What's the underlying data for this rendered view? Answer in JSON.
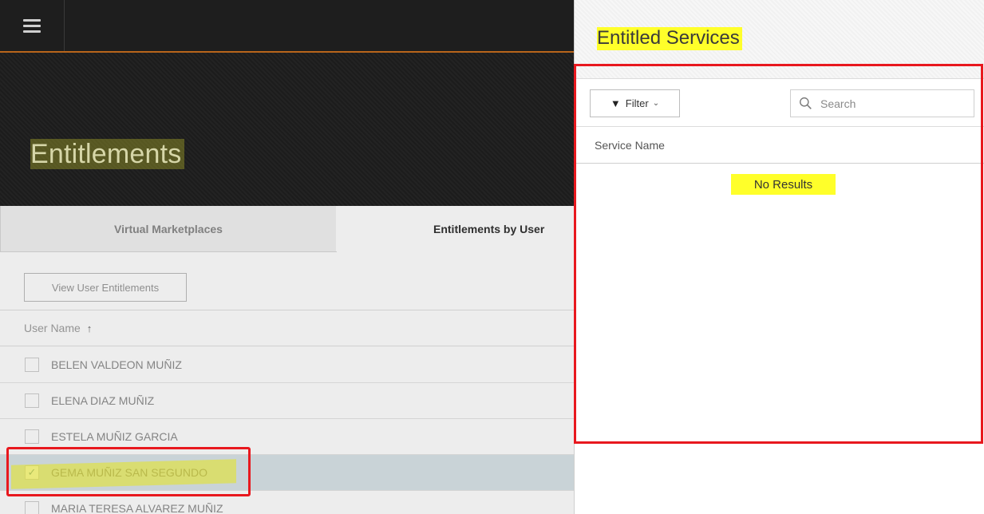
{
  "page": {
    "title": "Entitlements"
  },
  "tabs": [
    {
      "label": "Virtual Marketplaces"
    },
    {
      "label": "Entitlements by User"
    }
  ],
  "toolbar": {
    "view_button_label": "View User Entitlements"
  },
  "user_list": {
    "column_header": "User Name",
    "sort_indicator": "↑",
    "rows": [
      {
        "name": "BELEN VALDEON MUÑIZ",
        "checked": false
      },
      {
        "name": "ELENA DIAZ MUÑIZ",
        "checked": false
      },
      {
        "name": "ESTELA MUÑIZ GARCIA",
        "checked": false
      },
      {
        "name": "GEMA MUÑIZ SAN SEGUNDO",
        "checked": true
      },
      {
        "name": "MARIA TERESA ALVAREZ MUÑIZ",
        "checked": false
      }
    ]
  },
  "panel": {
    "title": "Entitled Services",
    "filter_label": "Filter",
    "search_placeholder": "Search",
    "column_header": "Service Name",
    "empty_text": "No Results"
  },
  "colors": {
    "annotation_red": "#e8181e",
    "highlight_yellow": "#ffff2a",
    "topbar_accent": "#b8651b",
    "selected_row": "#d9e4e8"
  },
  "icons": {
    "menu": "hamburger-menu-icon",
    "filter": "funnel-icon",
    "dropdown": "chevron-down-icon",
    "search": "search-icon",
    "sort": "arrow-up-icon",
    "checkbox": "checkbox-icon"
  }
}
